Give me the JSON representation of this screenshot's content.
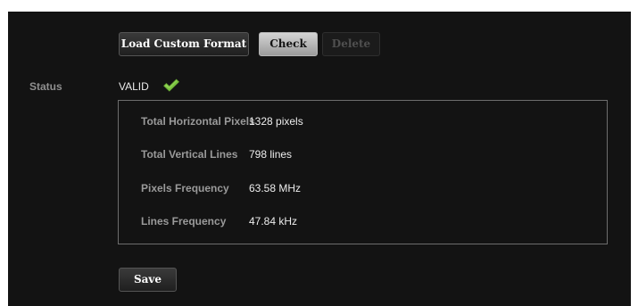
{
  "toolbar": {
    "load_custom_format_label": "Load Custom Format",
    "check_label": "Check",
    "delete_label": "Delete"
  },
  "status": {
    "label": "Status",
    "value": "VALID",
    "icon": "checkmark-icon",
    "icon_color": "#7cc242"
  },
  "details": [
    {
      "label": "Total Horizontal Pixels",
      "value": "1328 pixels"
    },
    {
      "label": "Total Vertical Lines",
      "value": "798 lines"
    },
    {
      "label": "Pixels Frequency",
      "value": "63.58 MHz"
    },
    {
      "label": "Lines Frequency",
      "value": "47.84 kHz"
    }
  ],
  "footer": {
    "save_label": "Save"
  }
}
